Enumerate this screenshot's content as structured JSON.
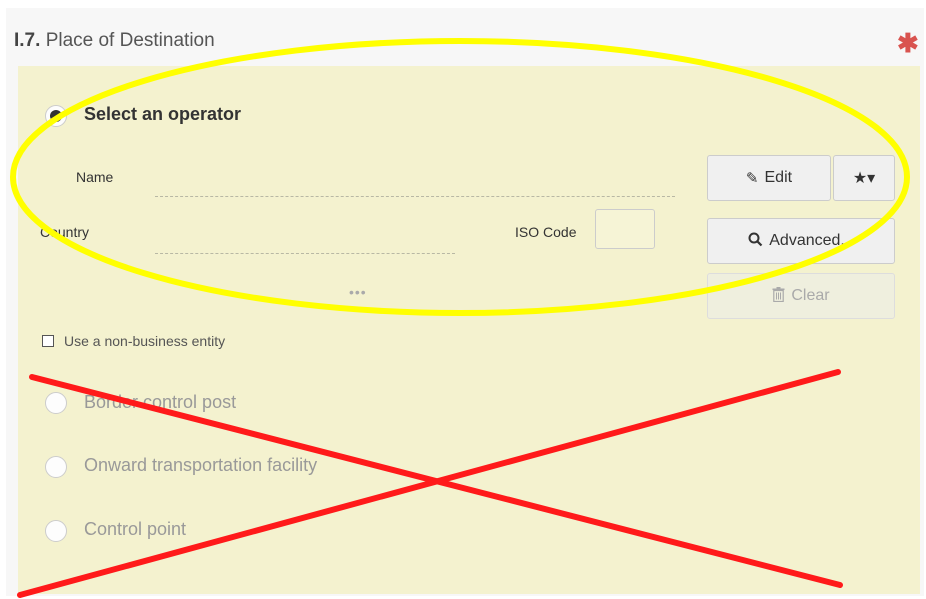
{
  "section": {
    "number": "I.7.",
    "title": "Place of Destination",
    "required_mark": "✱"
  },
  "operator": {
    "radio_label": "Select an operator",
    "name_label": "Name",
    "name_value": "",
    "country_label": "Country",
    "country_value": "",
    "iso_label": "ISO Code",
    "iso_value": "",
    "more": "•••"
  },
  "buttons": {
    "edit_label": "Edit",
    "favorites_label": "★▾",
    "advanced_label": "Advanced...",
    "clear_label": "Clear"
  },
  "non_business_label": "Use a non-business entity",
  "options": [
    {
      "label": "Border control post"
    },
    {
      "label": "Onward transportation facility"
    },
    {
      "label": "Control point"
    }
  ],
  "annotations": {
    "highlight_color": "#ffff00",
    "cross_color": "#ff1a1a"
  }
}
